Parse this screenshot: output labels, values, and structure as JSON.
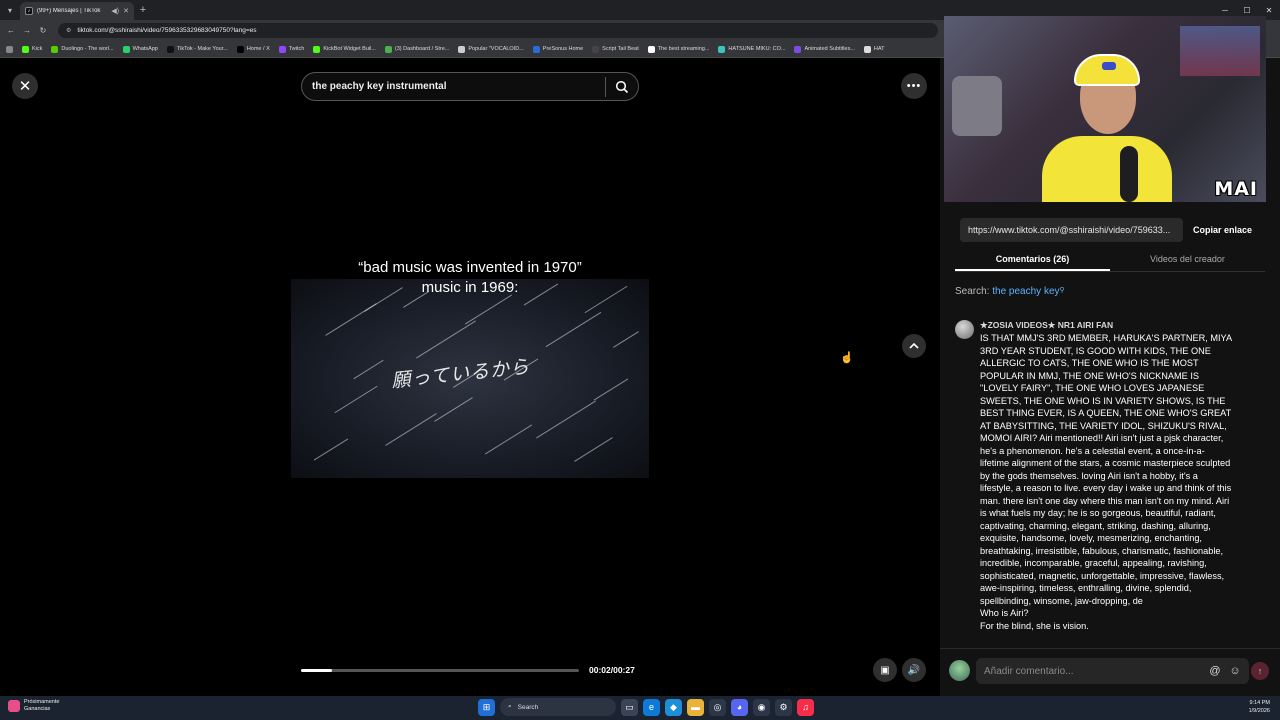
{
  "browser": {
    "tab_title": "(99+) Mensajes | TikTok",
    "url": "tiktok.com/@sshiraishi/video/7596335329683049750?lang=es",
    "bookmarks": [
      {
        "label": "Kick",
        "color": "#53fc18"
      },
      {
        "label": "Duolingo - The worl...",
        "color": "#58cc02"
      },
      {
        "label": "WhatsApp",
        "color": "#25d366"
      },
      {
        "label": "TikTok - Make Your...",
        "color": "#111111"
      },
      {
        "label": "Home / X",
        "color": "#000000"
      },
      {
        "label": "Twitch",
        "color": "#9146ff"
      },
      {
        "label": "KickBot Widget Buil...",
        "color": "#53fc18"
      },
      {
        "label": "(3) Dashboard / Stre...",
        "color": "#4caf50"
      },
      {
        "label": "Popular \"VOCALOID...",
        "color": "#cccccc"
      },
      {
        "label": "PreSonus Home",
        "color": "#2a6bd8"
      },
      {
        "label": "Script Tail Beat",
        "color": "#444444"
      },
      {
        "label": "The best streaming...",
        "color": "#ffffff"
      },
      {
        "label": "HATSUNE MIKU: CO...",
        "color": "#39c5bb"
      },
      {
        "label": "Animated Subtitles...",
        "color": "#7b4de0"
      },
      {
        "label": "HAT",
        "color": "#dddddd"
      }
    ]
  },
  "search": {
    "query": "the peachy key instrumental"
  },
  "video": {
    "caption_line1": "“bad music was invented in 1970”",
    "caption_line2": "music in 1969:",
    "frame_text": "願っているから",
    "time": "00:02/00:27",
    "progress": 0.11
  },
  "webcam": {
    "label": "MAI"
  },
  "share": {
    "link": "https://www.tiktok.com/@sshiraishi/video/759633...",
    "copy_label": "Copiar enlace"
  },
  "tabs": {
    "comments": "Comentarios (26)",
    "creator_videos": "Videos del creador"
  },
  "search_hint": {
    "prefix": "Search: ",
    "keyword": "the peachy key"
  },
  "comment": {
    "user": "★ZOSIA VIDEOS★ NR1 AIRI FAN",
    "text": "IS THAT MMJ'S 3RD MEMBER, HARUKA'S PARTNER, MIYA 3RD YEAR STUDENT, IS GOOD WITH KIDS, THE ONE ALLERGIC TO CATS, THE ONE WHO IS THE MOST POPULAR IN MMJ, THE ONE WHO'S NICKNAME IS \"LOVELY FAIRY\", THE ONE WHO LOVES JAPANESE SWEETS, THE ONE WHO IS IN VARIETY SHOWS, IS THE BEST THING EVER, IS A QUEEN, THE ONE WHO'S GREAT AT BABYSITTING, THE VARIETY IDOL, SHIZUKU'S RIVAL, MOMOI AIRI? Airi mentioned!! Airi isn't just a pjsk character, he's a phenomenon. he's a celestial event, a once-in-a-lifetime alignment of the stars, a cosmic masterpiece sculpted by the gods themselves. loving Airi isn't a hobby, it's a lifestyle, a reason to live. every day i wake up and think of this man. there isn't one day where this man isn't on my mind. Airi is what fuels my day; he is so gorgeous, beautiful, radiant, captivating, charming, elegant, striking, dashing, alluring, exquisite, handsome, lovely, mesmerizing, enchanting, breathtaking, irresistible, fabulous, charismatic, fashionable, incredible, incomparable, graceful, appealing, ravishing, sophisticated, magnetic, unforgettable, impressive, flawless, awe-inspiring, timeless, enthralling, divine, splendid, spellbinding, winsome, jaw-dropping, de\nWho is Airi?\nFor the blind, she is vision."
  },
  "comment_input": {
    "placeholder": "Añadir comentario..."
  },
  "taskbar": {
    "weather_line1": "Próximamente",
    "weather_line2": "Ganancias",
    "search_label": "Search",
    "time": "9:14 PM",
    "date": "1/9/2026"
  },
  "colors": {
    "link_blue": "#5fb3ff",
    "send_button": "#5b2330",
    "background": "#000000"
  }
}
